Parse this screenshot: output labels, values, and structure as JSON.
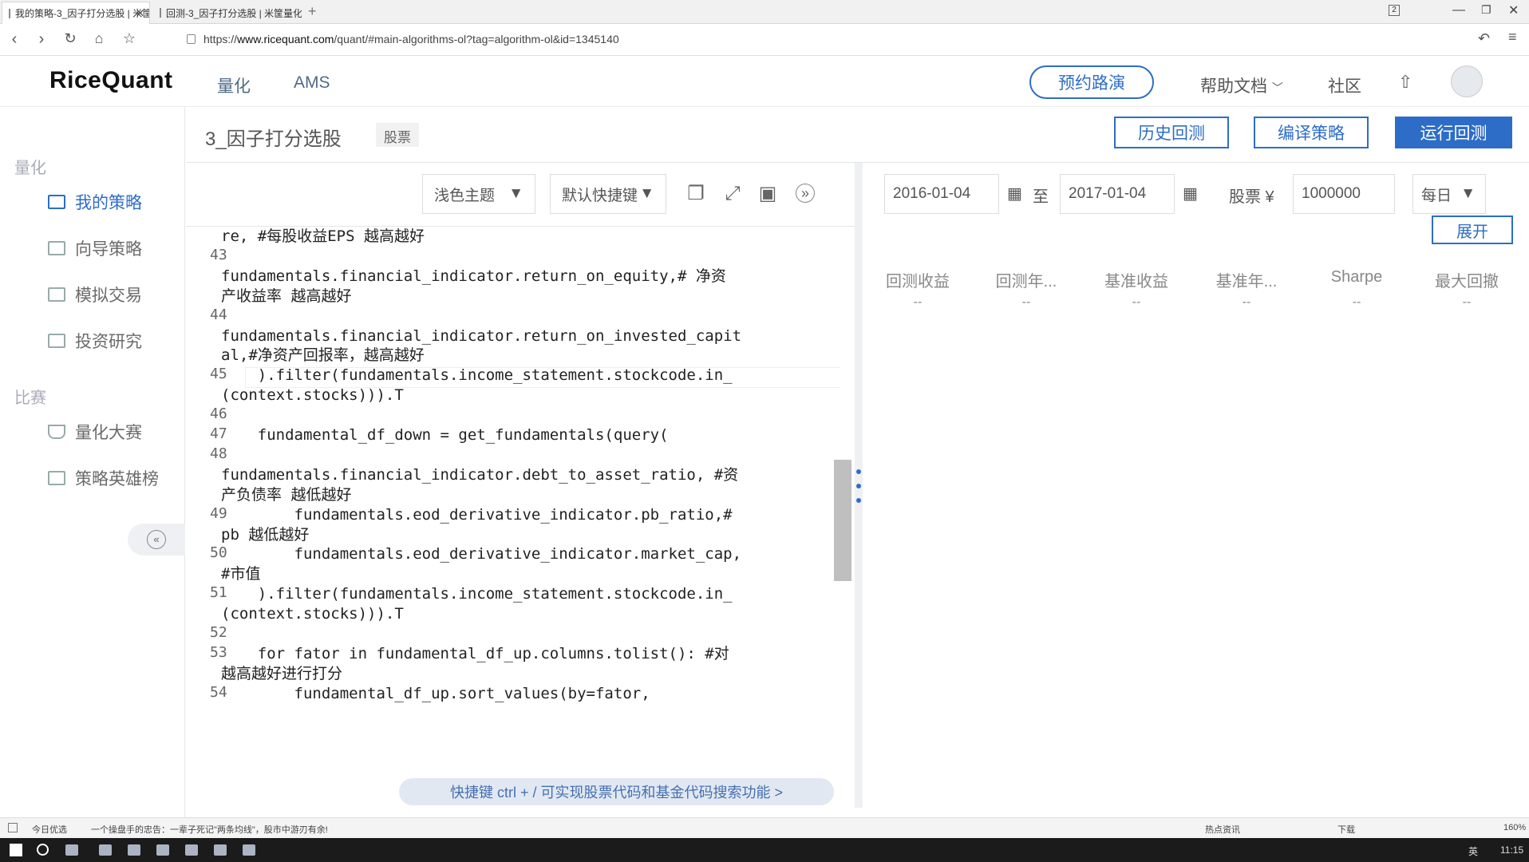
{
  "browser": {
    "tabs": [
      {
        "title": "我的策略-3_因子打分选股 | 米筐"
      },
      {
        "title": "回测-3_因子打分选股 | 米筐量化"
      }
    ],
    "url_prefix": "https://",
    "url_host": "www.ricequant.com",
    "url_path": "/quant/#main-algorithms-ol?tag=algorithm-ol&id=1345140",
    "tab_counter": "2"
  },
  "header": {
    "logo": "RiceQuant",
    "nav": [
      "量化",
      "AMS"
    ],
    "roadshow": "预约路演",
    "help": "帮助文档",
    "community": "社区"
  },
  "sidebar": {
    "section_quant": "量化",
    "items_quant": [
      {
        "label": "我的策略",
        "icon": "chart-icon",
        "active": true
      },
      {
        "label": "向导策略",
        "icon": "wizard-icon"
      },
      {
        "label": "模拟交易",
        "icon": "trade-icon"
      },
      {
        "label": "投资研究",
        "icon": "research-icon"
      }
    ],
    "section_contest": "比赛",
    "items_contest": [
      {
        "label": "量化大赛",
        "icon": "trophy-icon"
      },
      {
        "label": "策略英雄榜",
        "icon": "ranking-icon"
      }
    ],
    "collapse": "«"
  },
  "strategy": {
    "title": "3_因子打分选股",
    "tag": "股票",
    "history_btn": "历史回测",
    "compile_btn": "编译策略",
    "run_btn": "运行回测"
  },
  "editor": {
    "theme": "浅色主题",
    "keymap": "默认快捷键",
    "tip": "快捷键 ctrl + / 可实现股票代码和基金代码搜索功能 >"
  },
  "code_lines": [
    {
      "n": "",
      "text": "re, #每股收益EPS 越高越好"
    },
    {
      "n": "43",
      "text": ""
    },
    {
      "n": "",
      "text": "fundamentals.financial_indicator.return_on_equity,# 净资"
    },
    {
      "n": "",
      "text": "产收益率 越高越好"
    },
    {
      "n": "44",
      "text": ""
    },
    {
      "n": "",
      "text": "fundamentals.financial_indicator.return_on_invested_capit"
    },
    {
      "n": "",
      "text": "al,#净资产回报率，越高越好"
    },
    {
      "n": "45",
      "text": "    ).filter(fundamentals.income_statement.stockcode.in_"
    },
    {
      "n": "",
      "text": "(context.stocks))).T"
    },
    {
      "n": "46",
      "text": ""
    },
    {
      "n": "47",
      "text": "    fundamental_df_down = get_fundamentals(query("
    },
    {
      "n": "48",
      "text": ""
    },
    {
      "n": "",
      "text": "fundamentals.financial_indicator.debt_to_asset_ratio, #资"
    },
    {
      "n": "",
      "text": "产负债率 越低越好"
    },
    {
      "n": "49",
      "text": "        fundamentals.eod_derivative_indicator.pb_ratio,#"
    },
    {
      "n": "",
      "text": "pb 越低越好"
    },
    {
      "n": "50",
      "text": "        fundamentals.eod_derivative_indicator.market_cap,"
    },
    {
      "n": "",
      "text": "#市值"
    },
    {
      "n": "51",
      "text": "    ).filter(fundamentals.income_statement.stockcode.in_"
    },
    {
      "n": "",
      "text": "(context.stocks))).T"
    },
    {
      "n": "52",
      "text": ""
    },
    {
      "n": "53",
      "text": "    for fator in fundamental_df_up.columns.tolist(): #对"
    },
    {
      "n": "",
      "text": "越高越好进行打分"
    },
    {
      "n": "54",
      "text": "        fundamental_df_up.sort_values(by=fator,"
    }
  ],
  "backtest": {
    "start_date": "2016-01-04",
    "to": "至",
    "end_date": "2017-01-04",
    "capital_label": "股票 ¥",
    "capital": "1000000",
    "frequency": "每日",
    "expand": "展开",
    "metrics": [
      {
        "name": "回测收益",
        "value": "--"
      },
      {
        "name": "回测年...",
        "value": "--"
      },
      {
        "name": "基准收益",
        "value": "--"
      },
      {
        "name": "基准年...",
        "value": "--"
      },
      {
        "name": "Sharpe",
        "value": "--"
      },
      {
        "name": "最大回撤",
        "value": "--"
      }
    ]
  },
  "status": {
    "left": "今日优选",
    "news": "一个操盘手的忠告：一辈子死记\"两条均线\"，股市中游刃有余!",
    "right1": "热点资讯",
    "right2": "下载",
    "zoom": "160%"
  },
  "taskbar": {
    "ime": "英",
    "time": "11:15"
  },
  "colors": {
    "accent": "#2e6dc7"
  }
}
